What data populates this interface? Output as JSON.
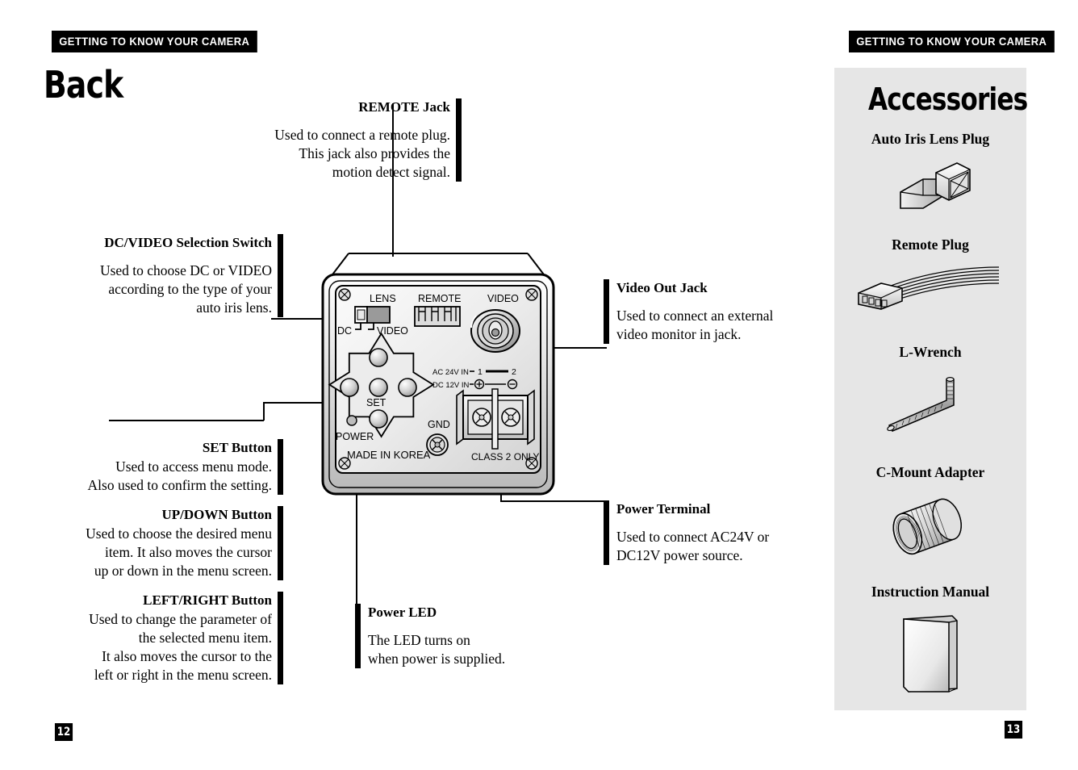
{
  "header": {
    "left_banner": "GETTING TO KNOW YOUR CAMERA",
    "right_banner": "GETTING TO KNOW YOUR CAMERA"
  },
  "left_page": {
    "title": "Back",
    "page_number": "12"
  },
  "right_page": {
    "title": "Accessories",
    "page_number": "13"
  },
  "callouts": [
    {
      "id": "remote-jack",
      "heading": "REMOTE Jack",
      "body": "Used to connect a remote plug. This jack also provides the motion detect signal.",
      "lines": [
        "Used to connect a remote plug.",
        "This jack also provides the",
        "motion detect signal."
      ],
      "align": "right"
    },
    {
      "id": "dc-video-selection-switch",
      "heading": "DC/VIDEO Selection Switch",
      "body": "Used to choose DC or VIDEO according to the type of your auto iris lens.",
      "lines": [
        "Used to choose DC or VIDEO",
        "according to the type of your",
        "auto iris lens."
      ],
      "align": "right"
    },
    {
      "id": "set-button",
      "heading": "SET Button",
      "body": "Used to access menu mode. Also used to confirm the setting.",
      "lines": [
        "Used to access menu mode.",
        "Also used to confirm the setting."
      ],
      "align": "right"
    },
    {
      "id": "up-down-button",
      "heading": "UP/DOWN Button",
      "body": "Used to choose the desired menu item. It also moves the cursor up or down in the menu screen.",
      "lines": [
        "Used to choose the desired menu",
        "item. It also moves the cursor",
        "up or down in the menu screen."
      ],
      "align": "right"
    },
    {
      "id": "left-right-button",
      "heading": "LEFT/RIGHT Button",
      "body": "Used to change the parameter of the selected menu item. It also moves the cursor to the left or right in the menu screen.",
      "lines": [
        "Used to change the parameter of",
        "the selected menu item.",
        "It also moves the cursor to the",
        "left or right in the menu screen."
      ],
      "align": "right"
    },
    {
      "id": "video-out-jack",
      "heading": "Video Out Jack",
      "body": "Used to connect an external video monitor in jack.",
      "lines": [
        "Used to connect an external",
        "video monitor in jack."
      ],
      "align": "left"
    },
    {
      "id": "power-terminal",
      "heading": "Power Terminal",
      "body": "Used to connect AC24V or DC12V power source.",
      "lines": [
        "Used to connect AC24V or",
        "DC12V power source."
      ],
      "align": "left"
    },
    {
      "id": "power-led",
      "heading": "Power LED",
      "body": "The LED turns on when power is supplied.",
      "lines": [
        "The LED turns on",
        "when power is supplied."
      ],
      "align": "left"
    }
  ],
  "diagram": {
    "labels": {
      "lens": "LENS",
      "dc": "DC",
      "video_switch": "VIDEO",
      "remote": "REMOTE",
      "video_jack": "VIDEO",
      "ac_in": "AC 24V IN",
      "ac_pin1": "1",
      "ac_pin2": "2",
      "dc_in": "DC 12V IN",
      "set": "SET",
      "power": "POWER",
      "gnd": "GND",
      "made_in": "MADE IN KOREA",
      "class2": "CLASS 2 ONLY"
    }
  },
  "accessories": {
    "items": [
      {
        "label": "Auto Iris Lens Plug",
        "icon": "connector-plug-icon"
      },
      {
        "label": "Remote Plug",
        "icon": "ribbon-cable-plug-icon"
      },
      {
        "label": "L-Wrench",
        "icon": "allen-wrench-icon"
      },
      {
        "label": "C-Mount Adapter",
        "icon": "lens-ring-icon"
      },
      {
        "label": "Instruction Manual",
        "icon": "booklet-icon"
      }
    ]
  },
  "colors": {
    "panel_bg": "#e6e6e6",
    "rule": "#000000",
    "body_bg": "#ffffff"
  }
}
